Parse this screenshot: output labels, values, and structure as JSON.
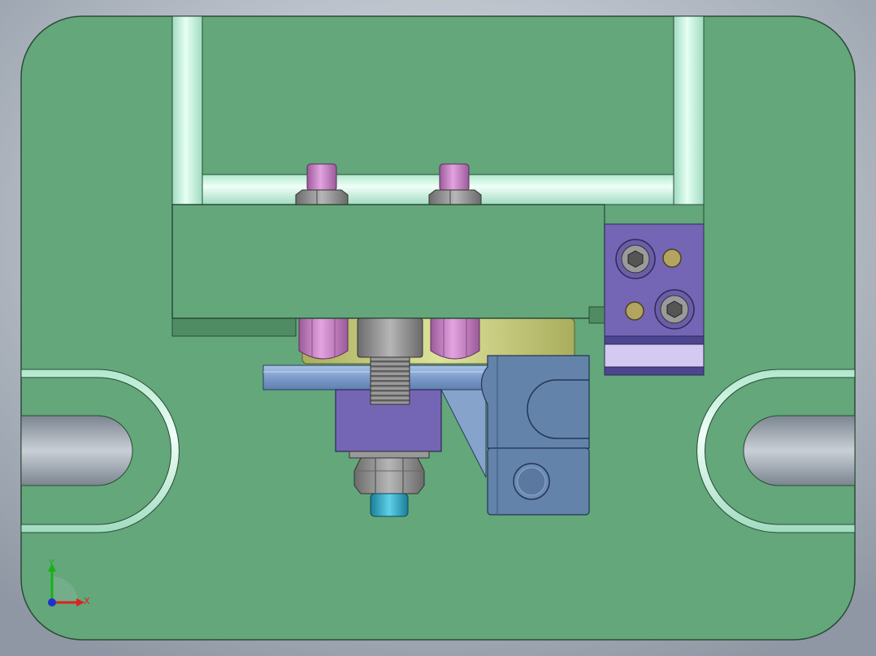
{
  "app": {
    "view": "front",
    "colors": {
      "background_light": "#e6eaf0",
      "background_dark": "#8e97a3",
      "plate": "#63a77b",
      "plate_edge": "#2c4a36",
      "frame": "#c6f2dc",
      "block_green": "#63a77b",
      "bracket_purple": "#7466b4",
      "nut_pink": "#c479c2",
      "hex_gray": "#8c8c8c",
      "clamp_blue": "#6483aa",
      "bar_blue": "#82a4d0",
      "cylinder_yellow": "#cbd07e",
      "brass": "#b4a461",
      "tip_cyan": "#2aa3c2"
    },
    "triad": {
      "x_label": "X",
      "y_label": "Y",
      "x_color": "#e02020",
      "y_color": "#18b018",
      "z_color": "#2030d0"
    }
  }
}
